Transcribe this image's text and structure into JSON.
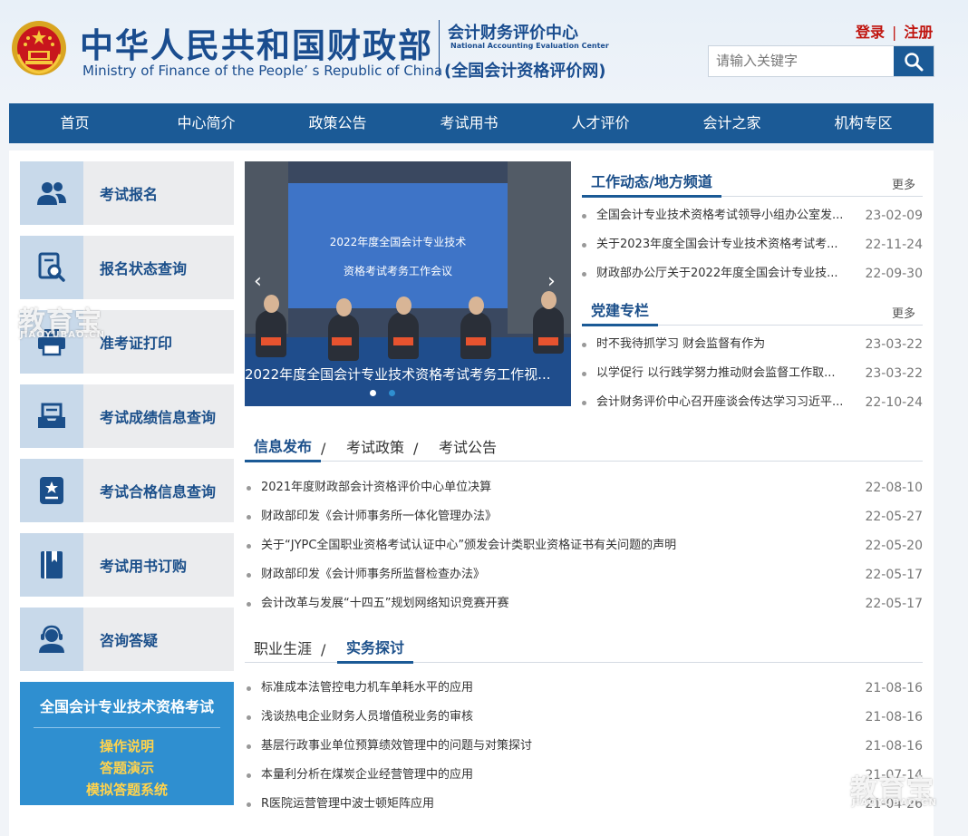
{
  "header": {
    "title_cn": "中华人民共和国财政部",
    "title_en": "Ministry of Finance of the People’ s Republic of China",
    "center_cn": "会计财务评价中心",
    "center_en": "National Accounting Evaluation Center",
    "center_net": "(全国会计资格评价网)",
    "login": "登录",
    "auth_sep": "|",
    "register": "注册",
    "search_placeholder": "请输入关键字"
  },
  "nav": [
    "首页",
    "中心简介",
    "政策公告",
    "考试用书",
    "人才评价",
    "会计之家",
    "机构专区"
  ],
  "sidebar": [
    {
      "label": "考试报名",
      "icon": "user-group-icon"
    },
    {
      "label": "报名状态查询",
      "icon": "document-search-icon"
    },
    {
      "label": "准考证打印",
      "icon": "printer-icon"
    },
    {
      "label": "考试成绩信息查询",
      "icon": "inbox-icon"
    },
    {
      "label": "考试合格信息查询",
      "icon": "certificate-icon"
    },
    {
      "label": "考试用书订购",
      "icon": "book-icon"
    },
    {
      "label": "咨询答疑",
      "icon": "support-agent-icon"
    }
  ],
  "promo": {
    "title": "全国会计专业技术资格考试",
    "links": [
      "操作说明",
      "答题演示",
      "模拟答题系统"
    ]
  },
  "carousel": {
    "screen_line1": "2022年度全国会计专业技术",
    "screen_line2": "资格考试考务工作会议",
    "caption": "2022年度全国会计专业技术资格考试考务工作视...",
    "prev": "‹",
    "next": "›"
  },
  "work_news": {
    "title": "工作动态/地方频道",
    "more": "更多",
    "items": [
      {
        "title": "全国会计专业技术资格考试领导小组办公室发...",
        "date": "23-02-09"
      },
      {
        "title": "关于2023年度全国会计专业技术资格考试考...",
        "date": "22-11-24"
      },
      {
        "title": "财政部办公厅关于2022年度全国会计专业技...",
        "date": "22-09-30"
      }
    ]
  },
  "party_news": {
    "title": "党建专栏",
    "more": "更多",
    "items": [
      {
        "title": "时不我待抓学习 财会监督有作为",
        "date": "23-03-22"
      },
      {
        "title": "以学促行 以行践学努力推动财会监督工作取...",
        "date": "23-03-22"
      },
      {
        "title": "会计财务评价中心召开座谈会传达学习习近平...",
        "date": "22-10-24"
      }
    ]
  },
  "info_tabs": {
    "tabs": [
      "信息发布",
      "考试政策",
      "考试公告"
    ],
    "sep": "/",
    "items": [
      {
        "title": "2021年度财政部会计资格评价中心单位决算",
        "date": "22-08-10"
      },
      {
        "title": "财政部印发《会计师事务所一体化管理办法》",
        "date": "22-05-27"
      },
      {
        "title": "关于“JYPC全国职业资格考试认证中心”颁发会计类职业资格证书有关问题的声明",
        "date": "22-05-20"
      },
      {
        "title": "财政部印发《会计师事务所监督检查办法》",
        "date": "22-05-17"
      },
      {
        "title": "会计改革与发展“十四五”规划网络知识竞赛开赛",
        "date": "22-05-17"
      }
    ]
  },
  "career_tabs": {
    "tabs": [
      "职业生涯",
      "实务探讨"
    ],
    "sep": "/",
    "items": [
      {
        "title": "标准成本法管控电力机车单耗水平的应用",
        "date": "21-08-16"
      },
      {
        "title": "浅谈热电企业财务人员增值税业务的审核",
        "date": "21-08-16"
      },
      {
        "title": "基层行政事业单位预算绩效管理中的问题与对策探讨",
        "date": "21-08-16"
      },
      {
        "title": "本量利分析在煤炭企业经营管理中的应用",
        "date": "21-07-14"
      },
      {
        "title": "R医院运营管理中波士顿矩阵应用",
        "date": "21-04-26"
      }
    ]
  },
  "watermark": {
    "cn": "教育宝",
    "en": "JIAOYUBAO.CN"
  },
  "colors": {
    "primary": "#1b5a96",
    "accent_red": "#c0140e",
    "promo_bg": "#2f8fd0",
    "promo_link": "#ffd34d"
  }
}
